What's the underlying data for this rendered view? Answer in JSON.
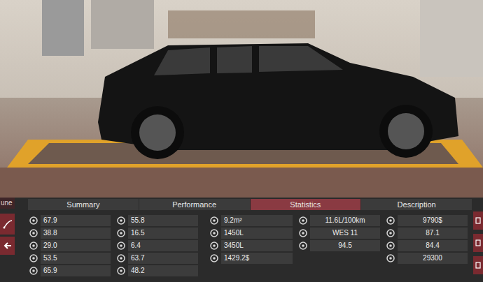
{
  "side_tab": {
    "label": "une"
  },
  "tabs": [
    {
      "label": "Summary",
      "selected": false
    },
    {
      "label": "Performance",
      "selected": false
    },
    {
      "label": "Statistics",
      "selected": true
    },
    {
      "label": "Description",
      "selected": false
    }
  ],
  "stats": [
    {
      "rows": [
        "67.9",
        "38.8",
        "29.0",
        "53.5",
        "65.9"
      ]
    },
    {
      "rows": [
        "55.8",
        "16.5",
        "6.4",
        "63.7",
        "48.2"
      ]
    },
    {
      "rows": [
        "9.2m²",
        "1450L",
        "3450L",
        "1429.2$"
      ]
    },
    {
      "rows": [
        "11.6L/100km",
        "WES 11",
        "94.5"
      ]
    },
    {
      "rows": [
        "9790$",
        "87.1",
        "84.4",
        "29300"
      ]
    }
  ]
}
